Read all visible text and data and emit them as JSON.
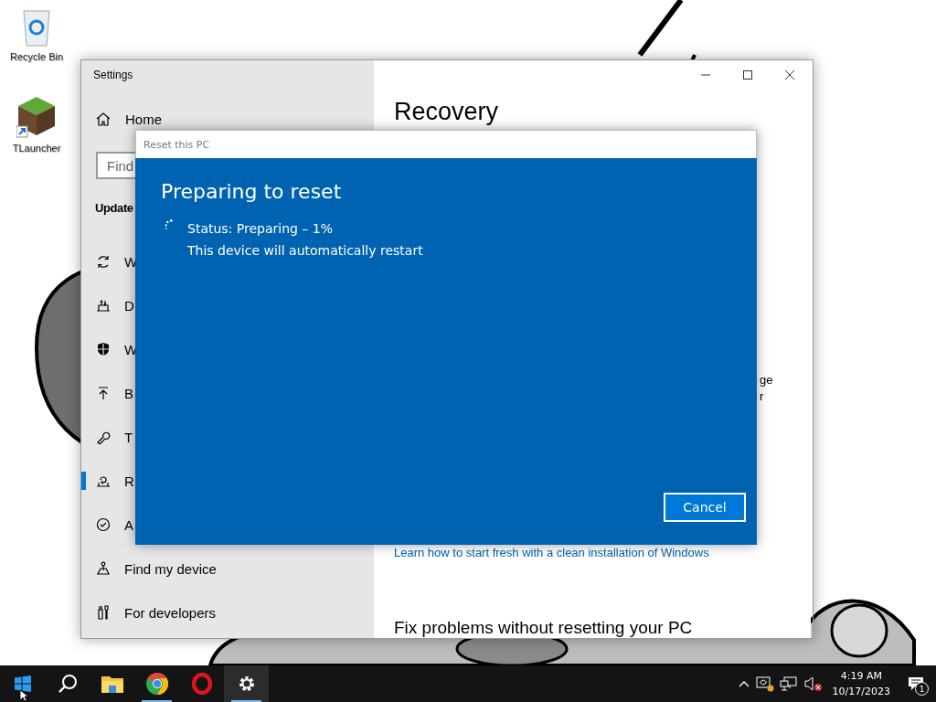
{
  "desktop_icons": [
    {
      "label": "Recycle Bin",
      "kind": "recycle"
    },
    {
      "label": "TLauncher",
      "kind": "grass"
    }
  ],
  "settings_window": {
    "title": "Settings",
    "sidebar": {
      "home": "Home",
      "search": {
        "placeholder": "Find"
      },
      "section": "Update",
      "items": [
        {
          "label": "W",
          "kind": "sync",
          "selected": false
        },
        {
          "label": "D",
          "kind": "delivery",
          "selected": false
        },
        {
          "label": "W",
          "kind": "shield",
          "selected": false
        },
        {
          "label": "B",
          "kind": "backup",
          "selected": false
        },
        {
          "label": "T",
          "kind": "wrench",
          "selected": false
        },
        {
          "label": "R",
          "kind": "recovery",
          "selected": true
        },
        {
          "label": "A",
          "kind": "check",
          "selected": false
        },
        {
          "label": "Find my device",
          "kind": "find",
          "selected": false
        },
        {
          "label": "For developers",
          "kind": "tools",
          "selected": false
        }
      ]
    },
    "content": {
      "title": "Recovery",
      "fragments": [
        "ge",
        "r"
      ],
      "link": "Learn how to start fresh with a clean installation of Windows",
      "heading": "Fix problems without resetting your PC"
    }
  },
  "dialog": {
    "title": "Reset this PC",
    "heading": "Preparing to reset",
    "status": "Status: Preparing – 1%",
    "note": "This device will automatically restart",
    "button": "Cancel"
  },
  "taskbar": {
    "apps": [
      {
        "kind": "start",
        "running": false
      },
      {
        "kind": "search",
        "running": false
      },
      {
        "kind": "explorer",
        "running": false
      },
      {
        "kind": "chrome",
        "running": true
      },
      {
        "kind": "opera",
        "running": false
      },
      {
        "kind": "settings",
        "running": true
      }
    ],
    "clock": {
      "time": "4:19 AM",
      "date": "10/17/2023"
    },
    "notification_count": "1"
  }
}
